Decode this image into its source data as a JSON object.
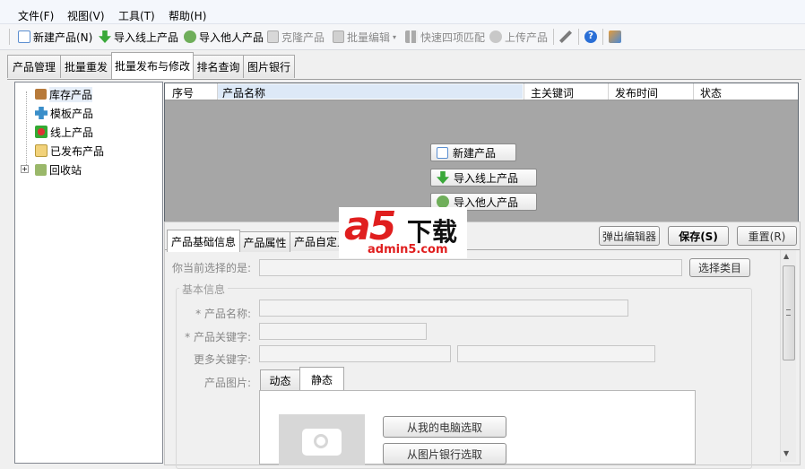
{
  "menubar": {
    "items": [
      "文件(F)",
      "视图(V)",
      "工具(T)",
      "帮助(H)"
    ]
  },
  "toolbar": {
    "new_product": "新建产品(N)",
    "import_online": "导入线上产品",
    "import_others": "导入他人产品",
    "clone": "克隆产品",
    "batch_edit": "批量编辑",
    "quick_match": "快速四项匹配",
    "upload": "上传产品"
  },
  "tabs": [
    "产品管理",
    "批量重发",
    "批量发布与修改",
    "排名查询",
    "图片银行"
  ],
  "active_tab": "批量发布与修改",
  "tree": {
    "items": [
      "库存产品",
      "模板产品",
      "线上产品",
      "已发布产品",
      "回收站"
    ]
  },
  "grid": {
    "columns": [
      "序号",
      "产品名称",
      "主关键词",
      "发布时间",
      "状态"
    ],
    "empty_actions": [
      "新建产品",
      "导入线上产品",
      "导入他人产品"
    ]
  },
  "detail": {
    "subtabs": [
      "产品基础信息",
      "产品属性",
      "产品自定义"
    ],
    "popup_editor": "弹出编辑器",
    "save": "保存(S)",
    "reset": "重置(R)",
    "current_selection_label": "你当前选择的是:",
    "select_category": "选择类目",
    "basic_info_group": "基本信息",
    "product_name_label": "* 产品名称:",
    "product_keyword_label": "* 产品关键字:",
    "more_keywords_label": "更多关键字:",
    "product_image_label": "产品图片:",
    "image_tabs": [
      "动态",
      "静态"
    ],
    "from_computer": "从我的电脑选取",
    "from_image_bank": "从图片银行选取"
  },
  "watermark": {
    "brand": "a5",
    "tagline": "下载",
    "site": "admin5.com"
  },
  "colors": {
    "grid_bg": "#a6a6a6",
    "watermark_red": "#e01e1e"
  }
}
